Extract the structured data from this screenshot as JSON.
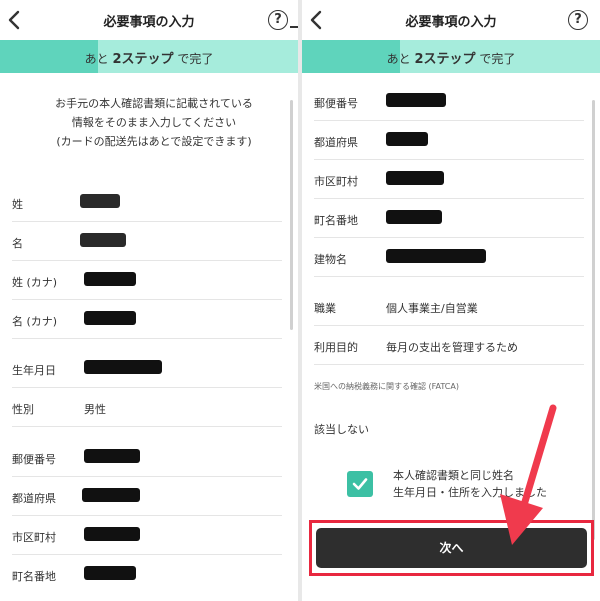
{
  "header": {
    "title": "必要事項の入力",
    "help_glyph": "?"
  },
  "progress": {
    "prefix": "あと ",
    "steps": "2ステップ",
    "suffix": " で完了",
    "fraction": 0.33
  },
  "intro": {
    "line1": "お手元の本人確認書類に記載されている",
    "line2": "情報をそのまま入力してください",
    "line3": "(カードの配送先はあとで設定できます)"
  },
  "left_form": [
    {
      "label": "姓"
    },
    {
      "label": "名"
    },
    {
      "label": "姓 (カナ)"
    },
    {
      "label": "名 (カナ)"
    },
    {
      "label": "生年月日"
    },
    {
      "label": "性別",
      "value": "男性"
    },
    {
      "label": "郵便番号"
    },
    {
      "label": "都道府県"
    },
    {
      "label": "市区町村"
    },
    {
      "label": "町名番地"
    }
  ],
  "right_form": {
    "address": [
      {
        "label": "郵便番号"
      },
      {
        "label": "都道府県"
      },
      {
        "label": "市区町村"
      },
      {
        "label": "町名番地"
      },
      {
        "label": "建物名"
      }
    ],
    "occupation": {
      "label": "職業",
      "value": "個人事業主/自営業"
    },
    "purpose": {
      "label": "利用目的",
      "value": "毎月の支出を管理するため"
    },
    "fatca_label": "米国への納税義務に関する確認 (FATCA)",
    "fatca_value": "該当しない"
  },
  "consent": {
    "checked": true,
    "line1": "本人確認書類と同じ姓名",
    "line2": "生年月日・住所を入力しました"
  },
  "next_button": {
    "label": "次へ"
  },
  "colors": {
    "accent": "#3cc0a4",
    "progress_bg": "#a6ecdc",
    "progress_fill": "#5fd4bc",
    "button_bg": "#2e2e2e",
    "highlight": "#e8283f"
  },
  "icons": [
    "back-chevron-icon",
    "help-circle-icon",
    "checkmark-icon",
    "annotation-arrow-icon"
  ]
}
